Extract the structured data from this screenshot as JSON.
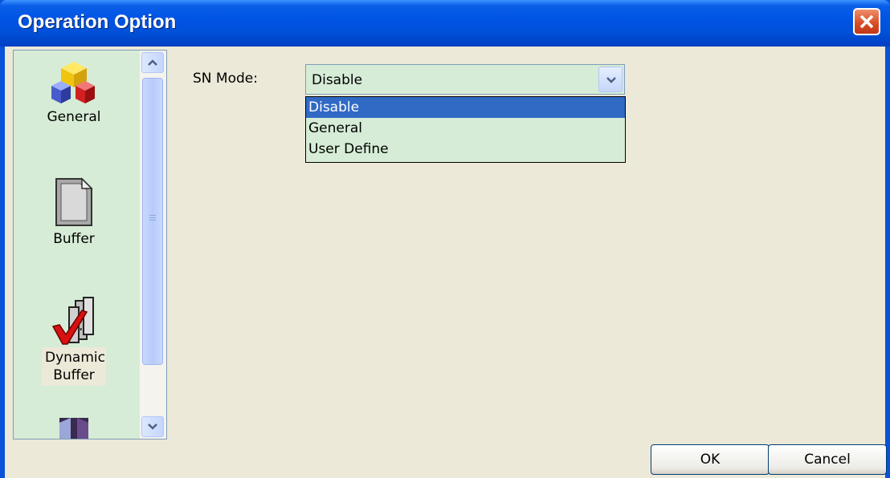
{
  "window": {
    "title": "Operation Option",
    "close_icon": "close-icon"
  },
  "sidebar": {
    "items": [
      {
        "label": "General",
        "icon": "cubes-icon",
        "selected": false
      },
      {
        "label": "Buffer",
        "icon": "document-icon",
        "selected": false
      },
      {
        "label": "Dynamic Buffer",
        "icon": "checkmark-buffer-icon",
        "selected": true
      },
      {
        "label": "",
        "icon": "partial-icon",
        "selected": false
      }
    ],
    "scroll_up_icon": "chevron-up-icon",
    "scroll_down_icon": "chevron-down-icon"
  },
  "form": {
    "sn_mode_label": "SN Mode:",
    "sn_mode_value": "Disable",
    "sn_mode_options": [
      "Disable",
      "General",
      "User Define"
    ],
    "sn_mode_highlighted": "Disable"
  },
  "buttons": {
    "ok_label": "OK",
    "cancel_label": "Cancel"
  },
  "colors": {
    "title_bar": "#0054e3",
    "list_bg": "#d6ecd6",
    "selection": "#316ac5",
    "dialog_bg": "#ece9d8"
  }
}
